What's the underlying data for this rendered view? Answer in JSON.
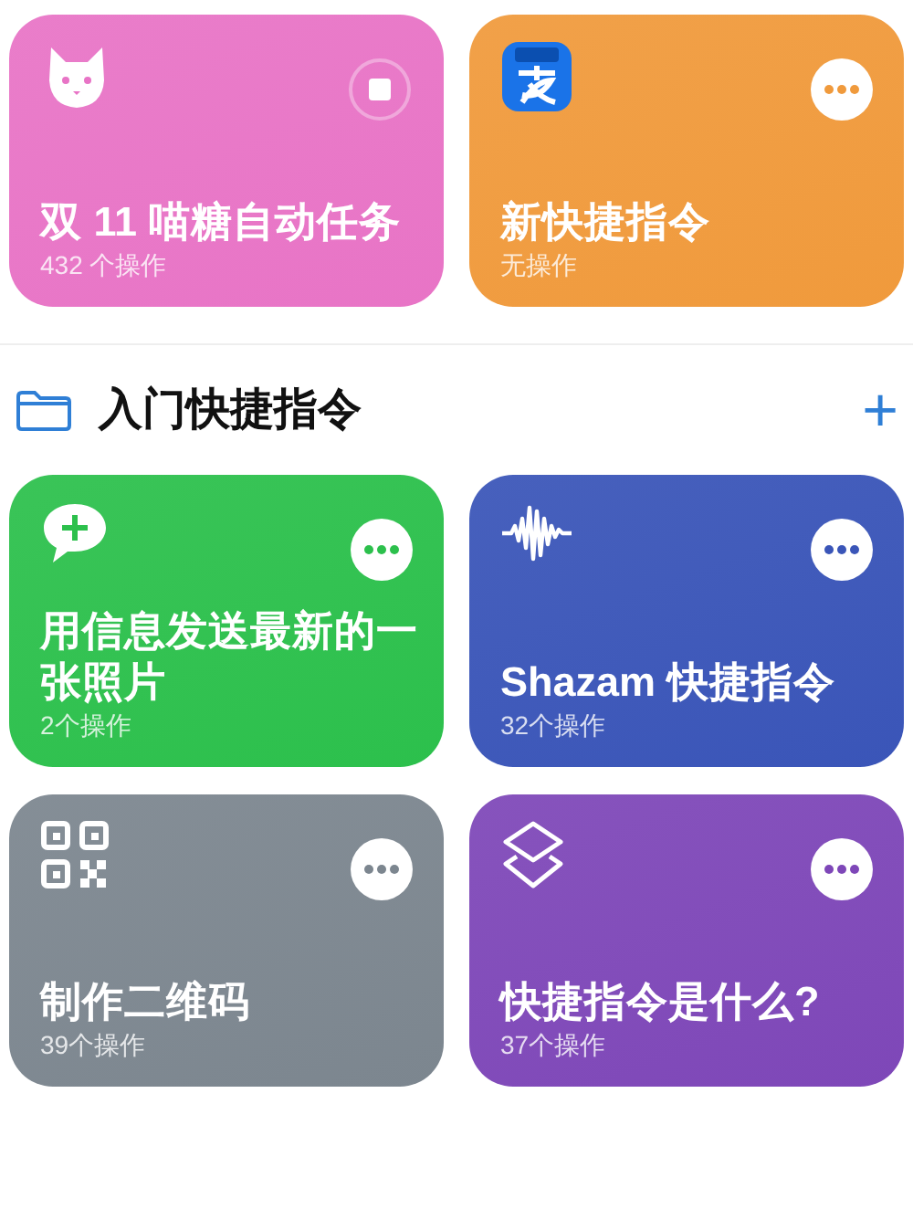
{
  "top_shortcuts": [
    {
      "title": "双 11 喵糖自动任务",
      "subtitle": "432 个操作",
      "color": "#e874c6",
      "kind": "cat",
      "running": true
    },
    {
      "title": "新快捷指令",
      "subtitle": "无操作",
      "color": "#f09a3c",
      "kind": "app",
      "running": false
    }
  ],
  "folder": {
    "title": "入门快捷指令",
    "add_label": "+"
  },
  "shortcuts": [
    {
      "title": "用信息发送最新的一张照片",
      "subtitle": "2个操作",
      "color": "#2cc04c",
      "kind": "message",
      "running": false
    },
    {
      "title": "Shazam 快捷指令",
      "subtitle": "32个操作",
      "color": "#3a55b8",
      "kind": "wave",
      "running": false
    },
    {
      "title": "制作二维码",
      "subtitle": "39个操作",
      "color": "#7c868f",
      "kind": "qr",
      "running": false
    },
    {
      "title": "快捷指令是什么?",
      "subtitle": "37个操作",
      "color": "#7e47b8",
      "kind": "layers",
      "running": false
    }
  ]
}
